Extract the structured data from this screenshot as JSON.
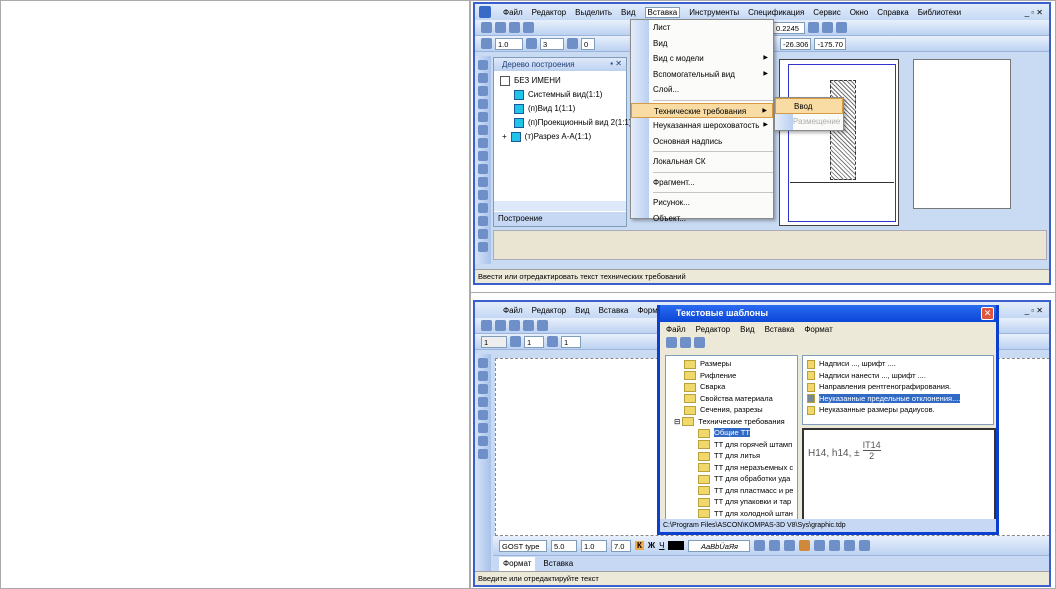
{
  "top": {
    "menu": [
      "Файл",
      "Редактор",
      "Выделить",
      "Вид",
      "Вставка",
      "Инструменты",
      "Спецификация",
      "Сервис",
      "Окно",
      "Справка",
      "Библиотеки"
    ],
    "active_menu": "Вставка",
    "toolbar": {
      "step": "1.0",
      "layer": "3",
      "style": "0",
      "zoom": "0.2245",
      "x": "-26.306",
      "y": "-175.70"
    },
    "tree": {
      "title": "Дерево построения",
      "root": "БЕЗ ИМЕНИ",
      "items": [
        "Системный вид(1:1)",
        "(п)Вид 1(1:1)",
        "(п)Проекционный вид 2(1:1)",
        "(т)Разрез А-А(1:1)"
      ],
      "tab": "Построение"
    },
    "insert_menu": [
      "Лист",
      "Вид",
      "Вид с модели",
      "Вспомогательный вид",
      "Слой...",
      "Технические требования",
      "Неуказанная шероховатость",
      "Основная надпись",
      "Локальная СК",
      "Фрагмент...",
      "Рисунок...",
      "Объект..."
    ],
    "submenu": {
      "enter": "Ввод",
      "place": "Размещение"
    },
    "status": "Ввести или отредактировать текст технических требований"
  },
  "bottom": {
    "menu": [
      "Файл",
      "Редактор",
      "Вид",
      "Вставка",
      "Формат"
    ],
    "toolbar": {
      "a": "1",
      "b": "1",
      "c": "1"
    },
    "dialog": {
      "title": "Текстовые шаблоны",
      "menu": [
        "Файл",
        "Редактор",
        "Вид",
        "Вставка",
        "Формат"
      ],
      "folders": [
        "Размеры",
        "Рифление",
        "Сварка",
        "Свойства материала",
        "Сечения, разрезы",
        "Технические требования"
      ],
      "subfolders": [
        "Общие ТТ",
        "ТТ для горячей штамп",
        "ТТ для литья",
        "ТТ для неразъемных с",
        "ТТ для обработки уда",
        "ТТ для пластмасс и ре",
        "ТТ для упаковки и тар",
        "ТТ для холодной штан"
      ],
      "templates": [
        "Надписи ..., шрифт ....",
        "Надписи нанести ..., шрифт ....",
        "Направления рентгенографирования.",
        "Неуказанные предельные отклонения....",
        "Неуказанные размеры радиусов."
      ],
      "preview": {
        "text": "H14, h14, ±",
        "num": "IT14",
        "den": "2"
      },
      "path": "C:\\Program Files\\ASCON\\KOMPAS-3D V8\\Sys\\graphic.tdp"
    },
    "format": {
      "font": "GOST type",
      "size": "5.0",
      "scale": "1.0",
      "spacing": "7.0",
      "bold": "К",
      "italic": "Ж",
      "underline": "Ч",
      "sample": "АаBbÜаЯя"
    },
    "tabs": [
      "Формат",
      "Вставка"
    ],
    "status": "Введите или отредактируйте текст"
  }
}
